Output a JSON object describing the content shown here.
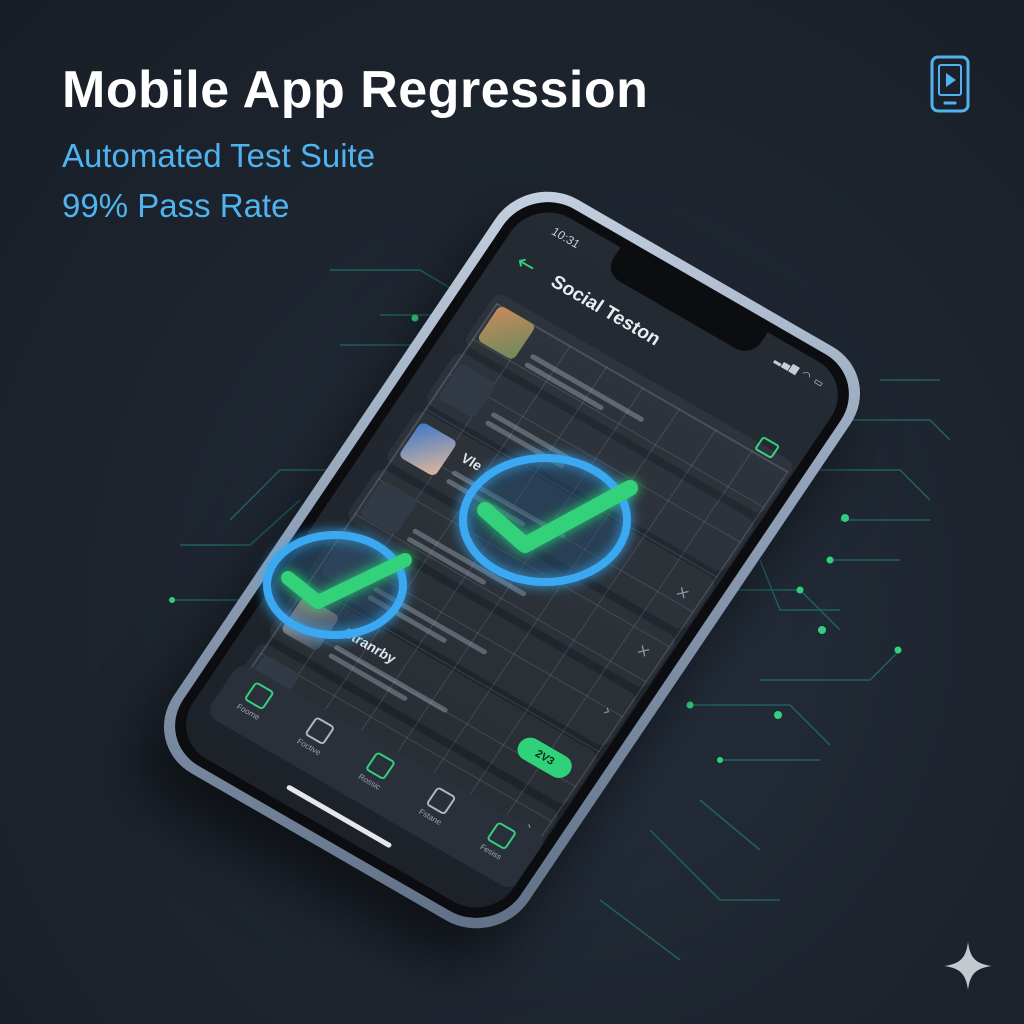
{
  "header": {
    "title": "Mobile App Regression",
    "subtitle": "Automated Test Suite",
    "pass_rate": "99% Pass Rate"
  },
  "icons": {
    "corner": "mobile-play-icon",
    "watermark": "sparkle-icon"
  },
  "colors": {
    "accent_blue": "#4fb3f0",
    "accent_green": "#35d07f",
    "background": "#1d242e"
  },
  "phone": {
    "time": "10:31",
    "app_title": "Social Teston",
    "feed": [
      {
        "name": "",
        "action": "",
        "avatar": "av1"
      },
      {
        "name": "",
        "action": "",
        "avatar": "av-muted"
      },
      {
        "name": "Vle",
        "action": "×",
        "avatar": "av2"
      },
      {
        "name": "",
        "action": "×",
        "avatar": "av-muted"
      },
      {
        "name": "",
        "action": "›",
        "avatar": "av-muted"
      },
      {
        "name": "Stranrby",
        "action": "",
        "pill": "2V3",
        "avatar": "av3"
      },
      {
        "name": "",
        "action": "›",
        "avatar": "av-muted"
      }
    ],
    "tabs": [
      {
        "label": "Foome"
      },
      {
        "label": "Foctive"
      },
      {
        "label": "Rossic"
      },
      {
        "label": "Fstane"
      },
      {
        "label": "Fesiss"
      }
    ]
  }
}
